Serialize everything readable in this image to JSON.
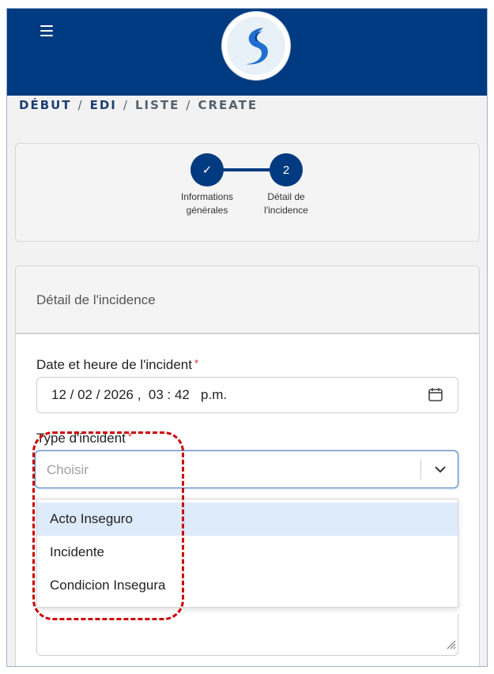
{
  "header": {
    "menu_icon": "hamburger-menu-icon",
    "logo": "brand-logo",
    "brand_color": "#003a80"
  },
  "breadcrumb": {
    "items": [
      "DÉBUT",
      "EDI",
      "LISTE",
      "CREATE"
    ],
    "separator": "/"
  },
  "stepper": {
    "steps": [
      {
        "marker": "✓",
        "label_line1": "Informations",
        "label_line2": "générales",
        "state": "completed"
      },
      {
        "marker": "2",
        "label_line1": "Détail de",
        "label_line2": "l'incidence",
        "state": "active"
      }
    ]
  },
  "form": {
    "title": "Détail de l'incidence",
    "datetime": {
      "label": "Date et heure de l'incident",
      "required_mark": "*",
      "value": "12 / 02 / 2026 ,  03 : 42   p.m.",
      "icon": "calendar-icon"
    },
    "incident_type": {
      "label": "Type d'incident",
      "required_mark": "*",
      "placeholder": "Choisir",
      "icon": "chevron-down-icon",
      "options": [
        "Acto Inseguro",
        "Incidente",
        "Condicion Insegura"
      ],
      "highlighted_option": "Acto Inseguro"
    },
    "textarea_icon": "resize-handle-icon"
  },
  "annotation": {
    "style": "dashed",
    "color": "#cc0000"
  }
}
